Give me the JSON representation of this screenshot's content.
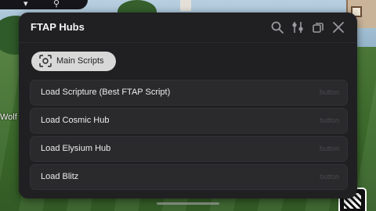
{
  "window": {
    "title": "FTAP Hubs"
  },
  "tabs": [
    {
      "label": "Main Scripts"
    }
  ],
  "items": [
    {
      "label": "Load Scripture (Best FTAP Script)",
      "type": "button"
    },
    {
      "label": "Load Cosmic Hub",
      "type": "button"
    },
    {
      "label": "Load Elysium Hub",
      "type": "button"
    },
    {
      "label": "Load Blitz",
      "type": "button"
    }
  ],
  "background": {
    "player_name": "Wolf"
  },
  "colors": {
    "panel": "#202022",
    "row": "#2a2a2d",
    "tab_active": "#d8d8d8",
    "title_text": "#f4f4f4"
  }
}
